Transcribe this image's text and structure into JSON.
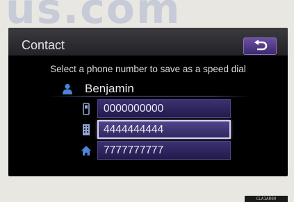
{
  "watermark": "us.com",
  "screen": {
    "title": "Contact",
    "back_icon": "return-arrow-icon",
    "prompt": "Select a phone number to save as a speed dial",
    "contact": {
      "icon": "person-icon",
      "name": "Benjamin"
    },
    "numbers": [
      {
        "icon": "mobile-phone-icon",
        "value": "0000000000",
        "selected": false
      },
      {
        "icon": "office-phone-icon",
        "value": "4444444444",
        "selected": true
      },
      {
        "icon": "home-icon",
        "value": "7777777777",
        "selected": false
      }
    ]
  },
  "figure_code": "CLA1AR00",
  "colors": {
    "accent": "#3c3172",
    "selected_border": "#d6d0f4",
    "icon_blue": "#4d84d8"
  }
}
